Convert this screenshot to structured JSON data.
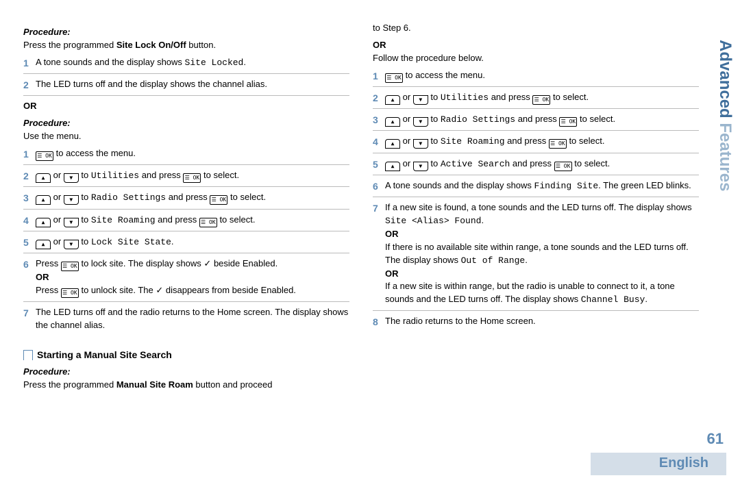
{
  "sideTab": {
    "word1": "Advanced",
    "word2": "Features"
  },
  "pageNumber": "61",
  "language": "English",
  "icons": {
    "ok": "☰ OK",
    "up": "▲",
    "down": "▼",
    "check": "✓"
  },
  "left": {
    "p1_label": "Procedure:",
    "p1_intro_a": "Press the programmed ",
    "p1_intro_b": "Site Lock On/Off",
    "p1_intro_c": " button.",
    "p1s1_a": "A tone sounds and the display shows ",
    "p1s1_b": "Site Locked",
    "p1s1_c": ".",
    "p1s2": "The LED turns off and the display shows the channel alias.",
    "or1": "OR",
    "p2_label": "Procedure:",
    "p2_intro": "Use the menu.",
    "p2s1": " to access the menu.",
    "p2s2_a": " or ",
    "p2s2_b": " to ",
    "p2s2_c": "Utilities",
    "p2s2_d": " and press ",
    "p2s2_e": " to select.",
    "p2s3_a": " or ",
    "p2s3_b": " to ",
    "p2s3_c": "Radio Settings",
    "p2s3_d": " and press ",
    "p2s3_e": " to select.",
    "p2s4_a": " or ",
    "p2s4_b": " to ",
    "p2s4_c": "Site Roaming",
    "p2s4_d": " and press ",
    "p2s4_e": " to select.",
    "p2s5_a": " or ",
    "p2s5_b": " to ",
    "p2s5_c": "Lock Site State",
    "p2s5_d": ".",
    "p2s6_a": "Press ",
    "p2s6_b": " to lock site. The display shows ",
    "p2s6_c": " beside Enabled.",
    "p2s6_or": "OR",
    "p2s6_d": "Press ",
    "p2s6_e": " to unlock site. The ",
    "p2s6_f": " disappears from beside Enabled.",
    "p2s7": "The LED turns off and the radio returns to the Home screen. The display shows the channel alias.",
    "subheading": "Starting a Manual Site Search",
    "p3_label": "Procedure:",
    "p3_intro_a": "Press the programmed ",
    "p3_intro_b": "Manual Site Roam",
    "p3_intro_c": " button and proceed"
  },
  "right": {
    "cont": "to Step 6.",
    "or": "OR",
    "intro": "Follow the procedure below.",
    "s1": " to access the menu.",
    "s2_a": " or ",
    "s2_b": " to ",
    "s2_c": "Utilities",
    "s2_d": " and press ",
    "s2_e": " to select.",
    "s3_a": " or ",
    "s3_b": " to ",
    "s3_c": "Radio Settings",
    "s3_d": " and press ",
    "s3_e": " to select.",
    "s4_a": " or ",
    "s4_b": " to ",
    "s4_c": "Site Roaming",
    "s4_d": " and press ",
    "s4_e": " to select.",
    "s5_a": " or ",
    "s5_b": " to ",
    "s5_c": "Active Search",
    "s5_d": " and press ",
    "s5_e": " to select.",
    "s6_a": "A tone sounds and the display shows ",
    "s6_b": "Finding Site",
    "s6_c": ". The green LED blinks.",
    "s7_a": "If a new site is found, a tone sounds and the LED turns off. The display shows ",
    "s7_b": "Site <Alias> Found",
    "s7_c": ".",
    "s7_or1": "OR",
    "s7_d": "If there is no available site within range, a tone sounds and the LED turns off. The display shows ",
    "s7_e": "Out of Range",
    "s7_f": ".",
    "s7_or2": "OR",
    "s7_g": "If a new site is within range, but the radio is unable to connect to it, a tone sounds and the LED turns off. The display shows ",
    "s7_h": "Channel Busy",
    "s7_i": ".",
    "s8": "The radio returns to the Home screen."
  }
}
